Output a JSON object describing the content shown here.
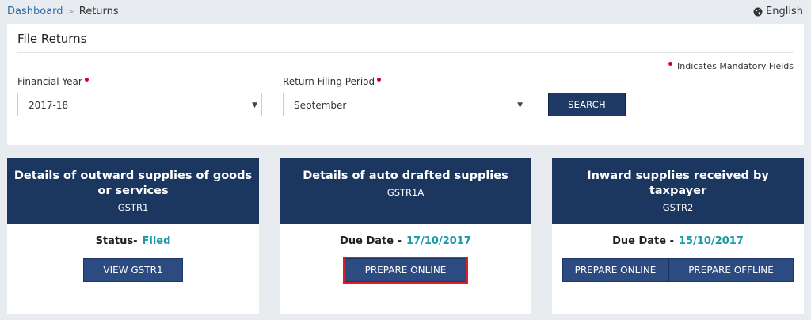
{
  "breadcrumb": {
    "home": "Dashboard",
    "separator": ">",
    "current": "Returns"
  },
  "language": {
    "label": "English",
    "icon": "globe-icon"
  },
  "panel": {
    "title": "File Returns",
    "mandatory_note": "Indicates Mandatory Fields",
    "financial_year": {
      "label": "Financial Year",
      "value": "2017-18"
    },
    "filing_period": {
      "label": "Return Filing Period",
      "value": "September"
    },
    "search_label": "SEARCH"
  },
  "cards": [
    {
      "title": "Details of outward supplies of goods or services",
      "code": "GSTR1",
      "status_label": "Status-",
      "status_value": "Filed",
      "buttons": [
        "VIEW GSTR1"
      ]
    },
    {
      "title": "Details of auto drafted supplies",
      "code": "GSTR1A",
      "status_label": "Due Date -",
      "status_value": "17/10/2017",
      "buttons": [
        "PREPARE ONLINE"
      ]
    },
    {
      "title": "Inward supplies received by taxpayer",
      "code": "GSTR2",
      "status_label": "Due Date -",
      "status_value": "15/10/2017",
      "buttons": [
        "PREPARE ONLINE",
        "PREPARE OFFLINE"
      ]
    }
  ],
  "colors": {
    "header_navy": "#1b3760",
    "button_blue": "#2c4b80",
    "status_teal": "#1a9aa8",
    "required_red": "#d0021b",
    "highlight_red": "#d8202b"
  }
}
